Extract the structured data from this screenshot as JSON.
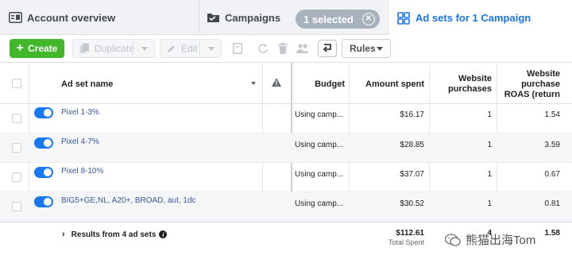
{
  "tabs": {
    "account": "Account overview",
    "campaigns": "Campaigns",
    "selected": "1 selected",
    "adsets": "Ad sets for 1 Campaign"
  },
  "toolbar": {
    "create": "Create",
    "duplicate": "Duplicate",
    "edit": "Edit",
    "rules": "Rules"
  },
  "columns": {
    "name": "Ad set name",
    "budget": "Budget",
    "amount_spent": "Amount spent",
    "purchases": [
      "Website",
      "purchases"
    ],
    "roas": [
      "Website",
      "purchase",
      "ROAS (return"
    ]
  },
  "rows": [
    {
      "name": "Pixel 1-3%",
      "budget": "Using camp...",
      "spent": "$16.17",
      "purchases": "1",
      "roas": "1.54"
    },
    {
      "name": "Pixel 4-7%",
      "budget": "Using camp...",
      "spent": "$28.85",
      "purchases": "1",
      "roas": "3.59"
    },
    {
      "name": "Pixel 8-10%",
      "budget": "Using camp...",
      "spent": "$37.07",
      "purchases": "1",
      "roas": "0.67"
    },
    {
      "name": "BIG5+GE,NL, A20+, BROAD, aut, 1dc",
      "budget": "Using camp...",
      "spent": "$30.52",
      "purchases": "1",
      "roas": "0.81"
    }
  ],
  "totals": {
    "results_label": "Results from 4 ad sets",
    "spent": "$112.61",
    "spent_sub": "Total Spent",
    "purchases": "4",
    "roas": "1.58"
  },
  "watermark": "熊猫出海Tom"
}
